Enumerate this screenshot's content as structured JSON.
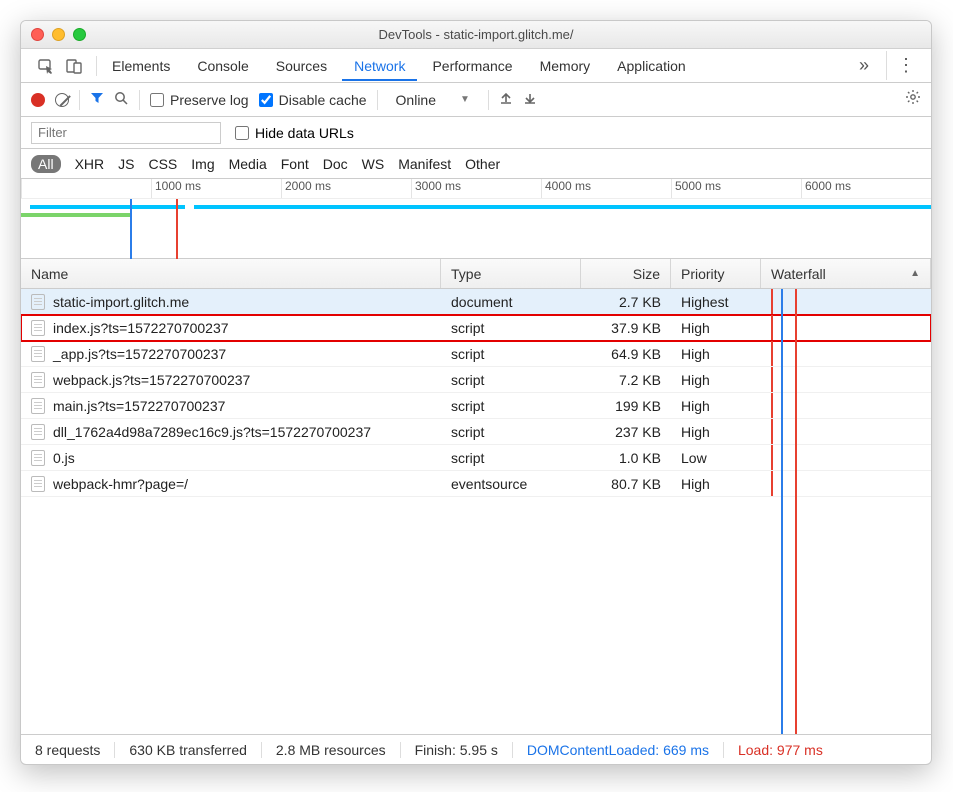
{
  "window_title": "DevTools - static-import.glitch.me/",
  "tabs": [
    "Elements",
    "Console",
    "Sources",
    "Network",
    "Performance",
    "Memory",
    "Application"
  ],
  "active_tab": "Network",
  "toolbar": {
    "preserve_log": "Preserve log",
    "disable_cache": "Disable cache",
    "throttling": "Online"
  },
  "filter": {
    "placeholder": "Filter",
    "hide_data_urls": "Hide data URLs"
  },
  "types": [
    "All",
    "XHR",
    "JS",
    "CSS",
    "Img",
    "Media",
    "Font",
    "Doc",
    "WS",
    "Manifest",
    "Other"
  ],
  "active_type": "All",
  "overview_ticks": [
    "",
    "1000 ms",
    "2000 ms",
    "3000 ms",
    "4000 ms",
    "5000 ms",
    "6000 ms"
  ],
  "columns": {
    "name": "Name",
    "type": "Type",
    "size": "Size",
    "priority": "Priority",
    "waterfall": "Waterfall"
  },
  "requests": [
    {
      "name": "static-import.glitch.me",
      "type": "document",
      "size": "2.7 KB",
      "priority": "Highest",
      "wfStart": 2,
      "wfLen": 4,
      "wfColor": "g",
      "selected": true
    },
    {
      "name": "index.js?ts=1572270700237",
      "type": "script",
      "size": "37.9 KB",
      "priority": "High",
      "wfStart": 4,
      "wfLen": 4,
      "wfColor": "g",
      "highlight": true
    },
    {
      "name": "_app.js?ts=1572270700237",
      "type": "script",
      "size": "64.9 KB",
      "priority": "High",
      "wfStart": 4,
      "wfLen": 4,
      "wfColor": "g"
    },
    {
      "name": "webpack.js?ts=1572270700237",
      "type": "script",
      "size": "7.2 KB",
      "priority": "High",
      "wfStart": 4,
      "wfLen": 4,
      "wfColor": "g"
    },
    {
      "name": "main.js?ts=1572270700237",
      "type": "script",
      "size": "199 KB",
      "priority": "High",
      "wfStart": 4,
      "wfLen": 6,
      "wfColor": "c"
    },
    {
      "name": "dll_1762a4d98a7289ec16c9.js?ts=1572270700237",
      "type": "script",
      "size": "237 KB",
      "priority": "High",
      "wfStart": 4,
      "wfLen": 6,
      "wfColor": "c"
    },
    {
      "name": "0.js",
      "type": "script",
      "size": "1.0 KB",
      "priority": "Low",
      "wfStart": 16,
      "wfLen": 3,
      "wfColor": "g"
    },
    {
      "name": "webpack-hmr?page=/",
      "type": "eventsource",
      "size": "80.7 KB",
      "priority": "High",
      "wfStart": 22,
      "wfLen": 78,
      "wfColor": "c"
    }
  ],
  "status": {
    "requests": "8 requests",
    "transferred": "630 KB transferred",
    "resources": "2.8 MB resources",
    "finish": "Finish: 5.95 s",
    "dcl": "DOMContentLoaded: 669 ms",
    "load": "Load: 977 ms"
  }
}
